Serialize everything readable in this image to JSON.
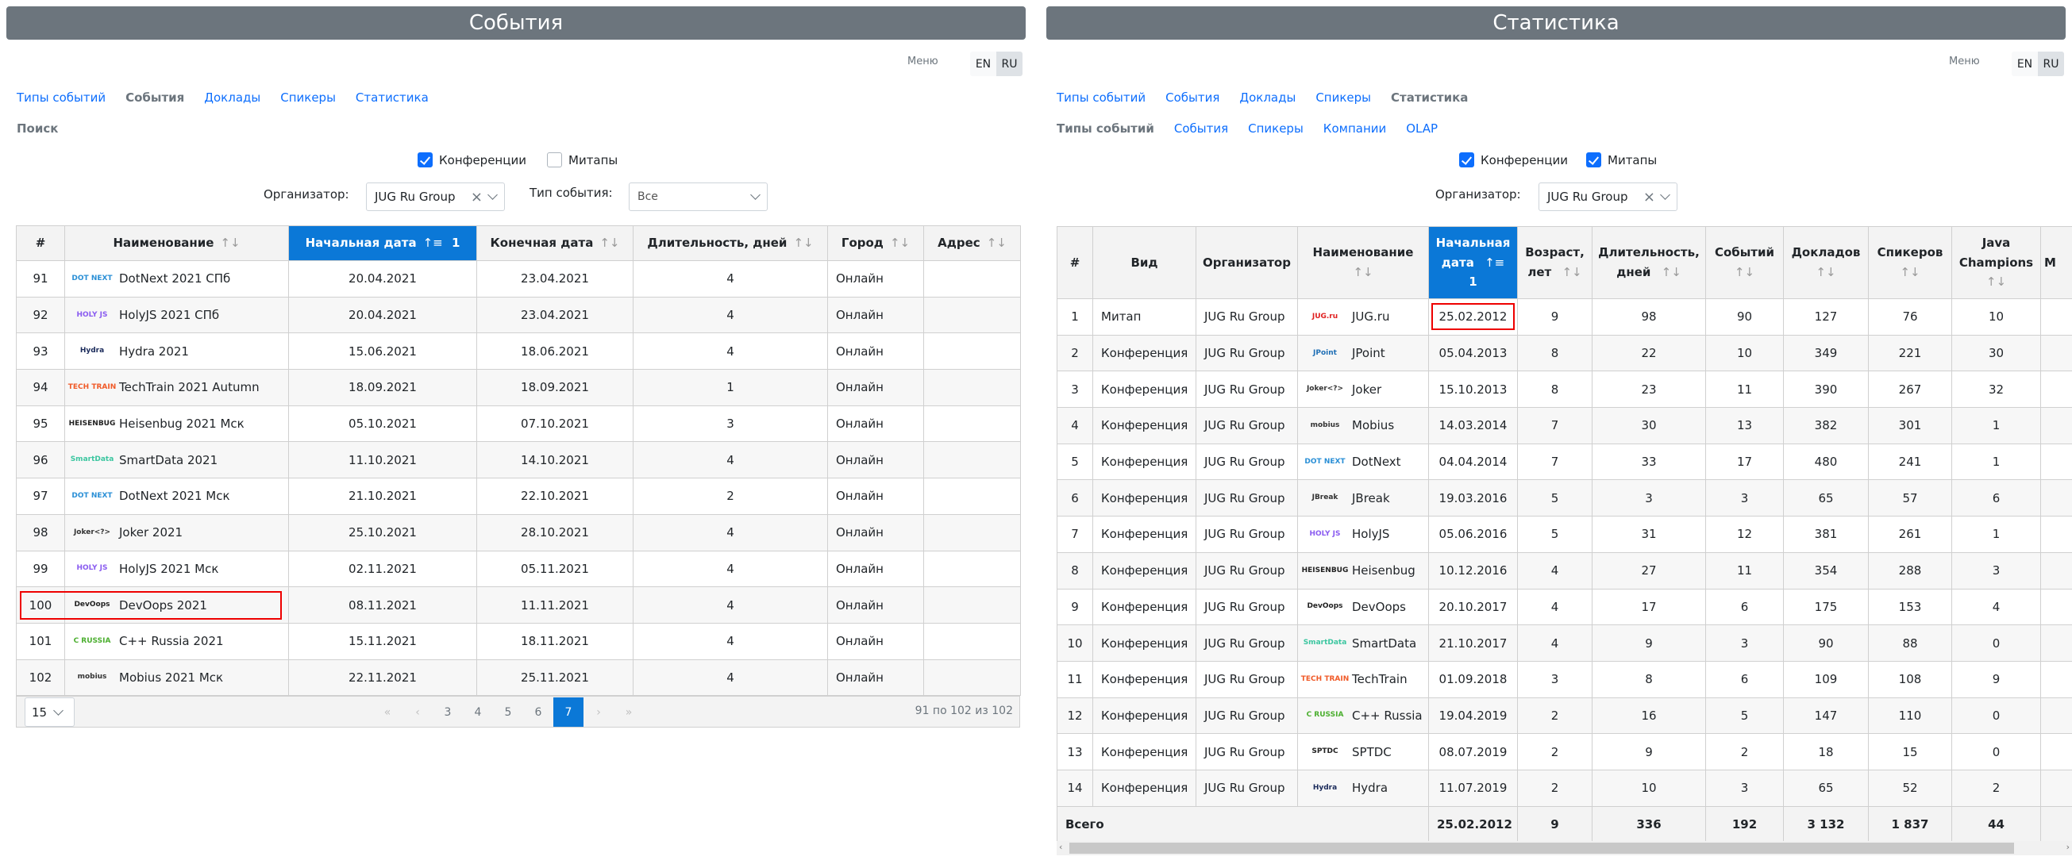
{
  "left": {
    "title": "События",
    "menu_label": "Меню",
    "lang": [
      "EN",
      "RU"
    ],
    "lang_active": "RU",
    "nav": [
      {
        "label": "Типы событий",
        "active": false
      },
      {
        "label": "События",
        "active": true
      },
      {
        "label": "Доклады",
        "active": false
      },
      {
        "label": "Спикеры",
        "active": false
      },
      {
        "label": "Статистика",
        "active": false
      }
    ],
    "subtitle": "Поиск",
    "filters": {
      "conferences_label": "Конференции",
      "conferences_checked": true,
      "meetups_label": "Митапы",
      "meetups_checked": false,
      "organizer_label": "Организатор:",
      "organizer_value": "JUG Ru Group",
      "event_type_label": "Тип события:",
      "event_type_value": "Все"
    },
    "table": {
      "columns": [
        "#",
        "Наименование",
        "Начальная дата",
        "Конечная дата",
        "Длительность, дней",
        "Город",
        "Адрес"
      ],
      "sort_icon": "↑↓",
      "sorted_icon": "↑≡",
      "sorted_order": "1",
      "rows": [
        {
          "num": "91",
          "logo": "dotnext-logo",
          "name": "DotNext 2021 СПб",
          "start": "20.04.2021",
          "end": "23.04.2021",
          "duration": "4",
          "city": "Онлайн",
          "address": ""
        },
        {
          "num": "92",
          "logo": "holyjs-logo",
          "name": "HolyJS 2021 СПб",
          "start": "20.04.2021",
          "end": "23.04.2021",
          "duration": "4",
          "city": "Онлайн",
          "address": ""
        },
        {
          "num": "93",
          "logo": "hydra-logo",
          "name": "Hydra 2021",
          "start": "15.06.2021",
          "end": "18.06.2021",
          "duration": "4",
          "city": "Онлайн",
          "address": ""
        },
        {
          "num": "94",
          "logo": "techtrain-logo",
          "name": "TechTrain 2021 Autumn",
          "start": "18.09.2021",
          "end": "18.09.2021",
          "duration": "1",
          "city": "Онлайн",
          "address": ""
        },
        {
          "num": "95",
          "logo": "heisenbug-logo",
          "name": "Heisenbug 2021 Мск",
          "start": "05.10.2021",
          "end": "07.10.2021",
          "duration": "3",
          "city": "Онлайн",
          "address": ""
        },
        {
          "num": "96",
          "logo": "smartdata-logo",
          "name": "SmartData 2021",
          "start": "11.10.2021",
          "end": "14.10.2021",
          "duration": "4",
          "city": "Онлайн",
          "address": ""
        },
        {
          "num": "97",
          "logo": "dotnext-logo",
          "name": "DotNext 2021 Мск",
          "start": "21.10.2021",
          "end": "22.10.2021",
          "duration": "2",
          "city": "Онлайн",
          "address": ""
        },
        {
          "num": "98",
          "logo": "joker-logo",
          "name": "Joker 2021",
          "start": "25.10.2021",
          "end": "28.10.2021",
          "duration": "4",
          "city": "Онлайн",
          "address": ""
        },
        {
          "num": "99",
          "logo": "holyjs-logo",
          "name": "HolyJS 2021 Мск",
          "start": "02.11.2021",
          "end": "05.11.2021",
          "duration": "4",
          "city": "Онлайн",
          "address": ""
        },
        {
          "num": "100",
          "logo": "devoops-logo",
          "name": "DevOops 2021",
          "start": "08.11.2021",
          "end": "11.11.2021",
          "duration": "4",
          "city": "Онлайн",
          "address": "",
          "highlighted": true
        },
        {
          "num": "101",
          "logo": "cpprussia-logo",
          "name": "C++ Russia 2021",
          "start": "15.11.2021",
          "end": "18.11.2021",
          "duration": "4",
          "city": "Онлайн",
          "address": ""
        },
        {
          "num": "102",
          "logo": "mobius-logo",
          "name": "Mobius 2021 Мск",
          "start": "22.11.2021",
          "end": "25.11.2021",
          "duration": "4",
          "city": "Онлайн",
          "address": ""
        }
      ]
    },
    "pager": {
      "page_size": "15",
      "first": "«",
      "prev": "‹",
      "next": "›",
      "last": "»",
      "pages": [
        "3",
        "4",
        "5",
        "6",
        "7"
      ],
      "current": "7",
      "info": "91 по 102 из 102"
    }
  },
  "right": {
    "title": "Статистика",
    "menu_label": "Меню",
    "lang": [
      "EN",
      "RU"
    ],
    "lang_active": "RU",
    "nav": [
      {
        "label": "Типы событий",
        "active": false
      },
      {
        "label": "События",
        "active": false
      },
      {
        "label": "Доклады",
        "active": false
      },
      {
        "label": "Спикеры",
        "active": false
      },
      {
        "label": "Статистика",
        "active": true
      }
    ],
    "subnav": [
      {
        "label": "Типы событий",
        "active": true
      },
      {
        "label": "События",
        "active": false
      },
      {
        "label": "Спикеры",
        "active": false
      },
      {
        "label": "Компании",
        "active": false
      },
      {
        "label": "OLAP",
        "active": false
      }
    ],
    "filters": {
      "conferences_label": "Конференции",
      "conferences_checked": true,
      "meetups_label": "Митапы",
      "meetups_checked": true,
      "organizer_label": "Организатор:",
      "organizer_value": "JUG Ru Group"
    },
    "table": {
      "columns": [
        "#",
        "Вид",
        "Организатор",
        "Наименование",
        "Начальная дата",
        "Возраст, лет",
        "Длительность, дней",
        "Событий",
        "Докладов",
        "Спикеров",
        "Java Champions",
        "M"
      ],
      "sort_icon": "↑↓",
      "sorted_icon": "↑≡",
      "sorted_order": "1",
      "rows": [
        {
          "num": "1",
          "kind": "Митап",
          "org": "JUG Ru Group",
          "logo": "jugru-logo",
          "name": "JUG.ru",
          "start": "25.02.2012",
          "age": "9",
          "duration": "98",
          "events": "90",
          "talks": "127",
          "speakers": "76",
          "jc": "10",
          "highlighted": true
        },
        {
          "num": "2",
          "kind": "Конференция",
          "org": "JUG Ru Group",
          "logo": "jpoint-logo",
          "name": "JPoint",
          "start": "05.04.2013",
          "age": "8",
          "duration": "22",
          "events": "10",
          "talks": "349",
          "speakers": "221",
          "jc": "30"
        },
        {
          "num": "3",
          "kind": "Конференция",
          "org": "JUG Ru Group",
          "logo": "joker-logo",
          "name": "Joker",
          "start": "15.10.2013",
          "age": "8",
          "duration": "23",
          "events": "11",
          "talks": "390",
          "speakers": "267",
          "jc": "32"
        },
        {
          "num": "4",
          "kind": "Конференция",
          "org": "JUG Ru Group",
          "logo": "mobius-logo",
          "name": "Mobius",
          "start": "14.03.2014",
          "age": "7",
          "duration": "30",
          "events": "13",
          "talks": "382",
          "speakers": "301",
          "jc": "1"
        },
        {
          "num": "5",
          "kind": "Конференция",
          "org": "JUG Ru Group",
          "logo": "dotnext-logo",
          "name": "DotNext",
          "start": "04.04.2014",
          "age": "7",
          "duration": "33",
          "events": "17",
          "talks": "480",
          "speakers": "241",
          "jc": "1"
        },
        {
          "num": "6",
          "kind": "Конференция",
          "org": "JUG Ru Group",
          "logo": "jbreak-logo",
          "name": "JBreak",
          "start": "19.03.2016",
          "age": "5",
          "duration": "3",
          "events": "3",
          "talks": "65",
          "speakers": "57",
          "jc": "6"
        },
        {
          "num": "7",
          "kind": "Конференция",
          "org": "JUG Ru Group",
          "logo": "holyjs-logo",
          "name": "HolyJS",
          "start": "05.06.2016",
          "age": "5",
          "duration": "31",
          "events": "12",
          "talks": "381",
          "speakers": "261",
          "jc": "1"
        },
        {
          "num": "8",
          "kind": "Конференция",
          "org": "JUG Ru Group",
          "logo": "heisenbug-logo",
          "name": "Heisenbug",
          "start": "10.12.2016",
          "age": "4",
          "duration": "27",
          "events": "11",
          "talks": "354",
          "speakers": "288",
          "jc": "3"
        },
        {
          "num": "9",
          "kind": "Конференция",
          "org": "JUG Ru Group",
          "logo": "devoops-logo",
          "name": "DevOops",
          "start": "20.10.2017",
          "age": "4",
          "duration": "17",
          "events": "6",
          "talks": "175",
          "speakers": "153",
          "jc": "4"
        },
        {
          "num": "10",
          "kind": "Конференция",
          "org": "JUG Ru Group",
          "logo": "smartdata-logo",
          "name": "SmartData",
          "start": "21.10.2017",
          "age": "4",
          "duration": "9",
          "events": "3",
          "talks": "90",
          "speakers": "88",
          "jc": "0"
        },
        {
          "num": "11",
          "kind": "Конференция",
          "org": "JUG Ru Group",
          "logo": "techtrain-logo",
          "name": "TechTrain",
          "start": "01.09.2018",
          "age": "3",
          "duration": "8",
          "events": "6",
          "talks": "109",
          "speakers": "108",
          "jc": "9"
        },
        {
          "num": "12",
          "kind": "Конференция",
          "org": "JUG Ru Group",
          "logo": "cpprussia-logo",
          "name": "C++ Russia",
          "start": "19.04.2019",
          "age": "2",
          "duration": "16",
          "events": "5",
          "talks": "147",
          "speakers": "110",
          "jc": "0"
        },
        {
          "num": "13",
          "kind": "Конференция",
          "org": "JUG Ru Group",
          "logo": "sptdc-logo",
          "name": "SPTDC",
          "start": "08.07.2019",
          "age": "2",
          "duration": "9",
          "events": "2",
          "talks": "18",
          "speakers": "15",
          "jc": "0"
        },
        {
          "num": "14",
          "kind": "Конференция",
          "org": "JUG Ru Group",
          "logo": "hydra-logo",
          "name": "Hydra",
          "start": "11.07.2019",
          "age": "2",
          "duration": "10",
          "events": "3",
          "talks": "65",
          "speakers": "52",
          "jc": "2"
        }
      ],
      "totals": {
        "label": "Всего",
        "start": "25.02.2012",
        "age": "9",
        "duration": "336",
        "events": "192",
        "talks": "3 132",
        "speakers": "1 837",
        "jc": "44"
      }
    },
    "scrollbar": {
      "left_arrow": "‹",
      "right_arrow": "›"
    }
  },
  "logos": {
    "dotnext-logo": {
      "text": "DOT NEXT",
      "color": "#2a8fd6"
    },
    "holyjs-logo": {
      "text": "HOLY JS",
      "color": "#8a5cf0"
    },
    "hydra-logo": {
      "text": "Hydra",
      "color": "#1a2a5a"
    },
    "techtrain-logo": {
      "text": "TECH TRAIN",
      "color": "#f05a28"
    },
    "heisenbug-logo": {
      "text": "HEISENBUG",
      "color": "#222222"
    },
    "smartdata-logo": {
      "text": "SmartData",
      "color": "#3cc6a0"
    },
    "joker-logo": {
      "text": "Joker<?>",
      "color": "#333333"
    },
    "devoops-logo": {
      "text": "DevOops",
      "color": "#222222"
    },
    "cpprussia-logo": {
      "text": "C RUSSIA",
      "color": "#4caf30"
    },
    "mobius-logo": {
      "text": "mobius",
      "color": "#333333"
    },
    "jugru-logo": {
      "text": "JUG.ru",
      "color": "#e02020"
    },
    "jpoint-logo": {
      "text": "JPoint",
      "color": "#1f6fb5"
    },
    "jbreak-logo": {
      "text": "JBreak",
      "color": "#333333"
    },
    "sptdc-logo": {
      "text": "SPTDC",
      "color": "#222222"
    }
  }
}
